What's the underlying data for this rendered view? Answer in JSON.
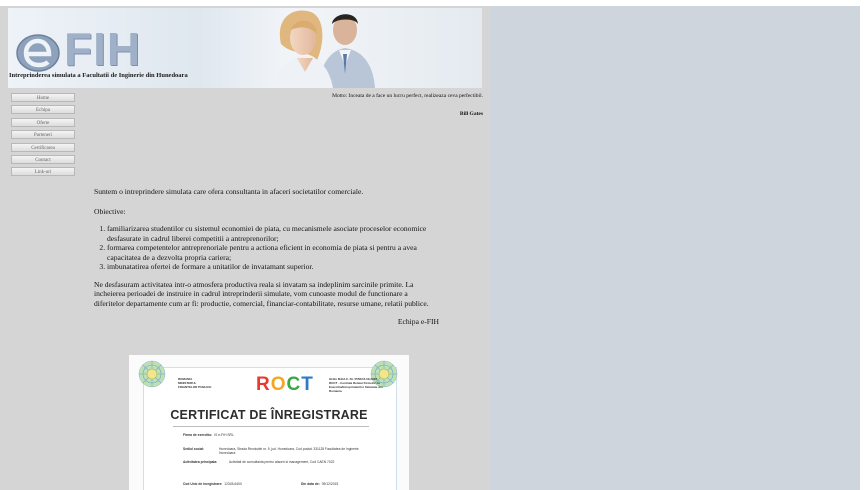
{
  "banner": {
    "logo_text": "FIH",
    "subtitle": "Intreprinderea simulata a Facultatii de Inginerie din Hunedoara"
  },
  "menu": [
    {
      "label": "Home"
    },
    {
      "label": "Echipa"
    },
    {
      "label": "Oferte"
    },
    {
      "label": "Parteneri"
    },
    {
      "label": "Certificarea"
    },
    {
      "label": "Contact"
    },
    {
      "label": "Link-uri"
    }
  ],
  "motto": {
    "text": "Motto: Inceata de a face un lucru perfect, realizeaza ceva perfectibil.",
    "author": "Bill Gates"
  },
  "content": {
    "intro": "Suntem o intreprindere simulata care ofera consultanta in afaceri societatilor comerciale.",
    "objectives_heading": "Obiective:",
    "objectives": [
      "familiarizarea studentilor cu sistemul economiei de piata, cu mecanismele asociate proceselor economice desfasurate in cadrul liberei competitii a antreprenorilor;",
      "formarea competentelor antreprenoriale pentru a actiona eficient in economia de piata si pentru a avea capacitatea de a dezvolta propria cariera;",
      "imbunatatirea ofertei de formare a unitatilor de invatamant superior."
    ],
    "paragraph": "Ne desfasuram activitatea intr-o atmosfera productiva reala si invatam sa indeplinim sarcinile primite. La incheierea perioadei de instruire in cadrul intreprinderii simulate, vom cunoaste modul de functionare a diferitelor departamente cum ar fi: productie, comercial, financiar-contabilitate, resurse umane, relatii publice.",
    "signature": "Echipa e-FIH"
  },
  "certificate": {
    "header_left": [
      "ROMANIA",
      "MINISTERUL",
      "FINANTELOR PUBLICE"
    ],
    "logo": {
      "r": "R",
      "o": "O",
      "c": "C",
      "t": "T"
    },
    "header_right": [
      "Ordin M.Ed.C. Nr. 5550/15.09.2008",
      "ROCT - Centrala Retelei Firmelor de Exercitiu/Intreprinderilor Simulate din Romania"
    ],
    "title": "CERTIFICAT DE ÎNREGISTRARE",
    "firma_label": "Firma de exercitiu:",
    "firma_value": "IS e-FIH SRL",
    "sediu_label": "Sediul social:",
    "sediu_value": "Hunedoara, Strada Revolutiei nr. 5, jud. Hunedoara, Cod postal: 331128 Facultatea de Inginerie Hunedoara",
    "activitate_label": "Activitatea principala:",
    "activitate_value": "Activitati de consultanta pentru afaceri si management, Cod CAEN 7022",
    "cod_label": "Cod Unic de Inregistrare:",
    "cod_value": "12345-6400",
    "data_label": "Din data de:",
    "data_value": "09/12/2015"
  },
  "colors": {
    "page_bg": "#d5d5d5",
    "right_panel_bg": "#cfd5dc",
    "logo_color": "#9fb0c8"
  }
}
